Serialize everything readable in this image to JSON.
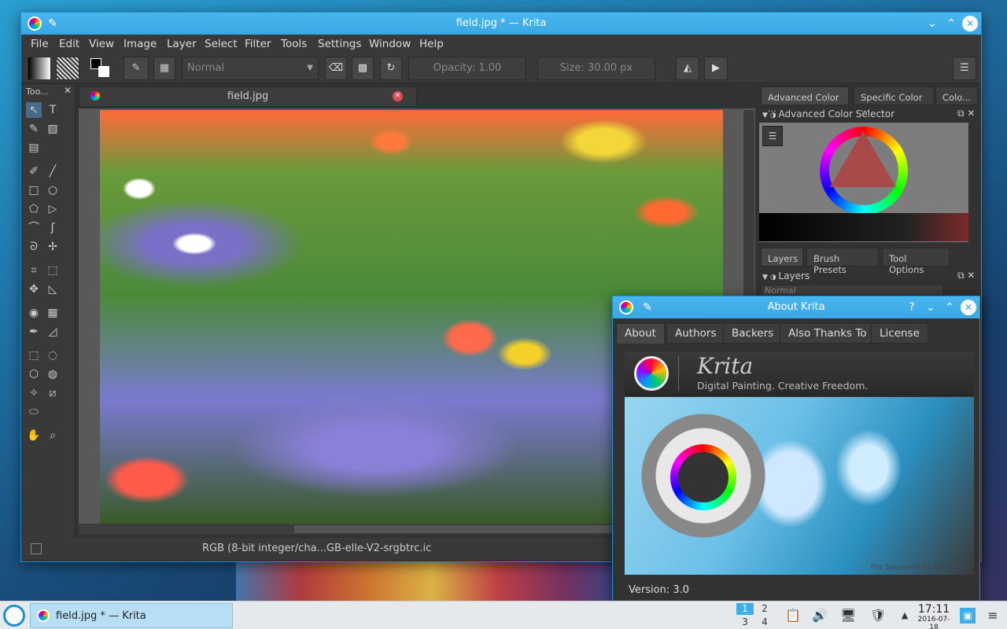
{
  "main_window": {
    "title": "field.jpg * — Krita",
    "menu": [
      "File",
      "Edit",
      "View",
      "Image",
      "Layer",
      "Select",
      "Filter",
      "Tools",
      "Settings",
      "Window",
      "Help"
    ],
    "toolbar": {
      "blend_mode": "Normal",
      "opacity_label": "Opacity:",
      "opacity_value": "1.00",
      "size_label": "Size:",
      "size_value": "30.00 px"
    },
    "toolbox_title": "Too...",
    "doc_tab": "field.jpg",
    "status_text": "RGB (8-bit integer/cha...GB-elle-V2-srgbtrc.ic"
  },
  "dockers": {
    "color_tabs": [
      "Advanced Color ...",
      "Specific Color ...",
      "Colo..."
    ],
    "color_panel_title": "Advanced Color Selector",
    "layer_tabs": [
      "Layers",
      "Brush Presets",
      "Tool Options"
    ],
    "layers_panel_title": "Layers",
    "layers_blend_mode": "Normal"
  },
  "about_dialog": {
    "title": "About Krita",
    "tabs": [
      "About",
      "Authors",
      "Backers",
      "Also Thanks To",
      "License"
    ],
    "app_name": "Krita",
    "tagline": "Digital Painting. Creative Freedom.",
    "splash_credit": "The Sequence by Tyson Tan",
    "version": "Version: 3.0"
  },
  "taskbar": {
    "task_label": "field.jpg * — Krita",
    "pager": [
      "1",
      "2",
      "3",
      "4"
    ],
    "time": "17:11",
    "date": "2016-07-18"
  },
  "colors": {
    "accent": "#3daee9",
    "window_bg": "#323232",
    "taskbar_bg": "#e6e9ec"
  }
}
